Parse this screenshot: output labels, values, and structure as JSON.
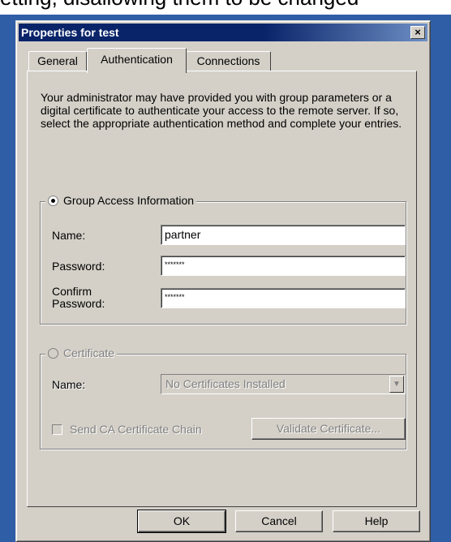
{
  "background_text": "etting, disallowing them to be changed",
  "dialog": {
    "title": "Properties for test",
    "close_glyph": "×"
  },
  "tabs": [
    {
      "label": "General",
      "active": false
    },
    {
      "label": "Authentication",
      "active": true
    },
    {
      "label": "Connections",
      "active": false
    }
  ],
  "intro_text": "Your administrator may have provided you with group parameters or a digital certificate to authenticate your access to the remote server.  If so, select the appropriate authentication method and complete your entries.",
  "group_access": {
    "legend": "Group Access Information",
    "selected": true,
    "name_label": "Name:",
    "name_value": "partner",
    "password_label": "Password:",
    "password_value": "*******",
    "confirm_label": "Confirm Password:",
    "confirm_value": "*******"
  },
  "certificate": {
    "legend": "Certificate",
    "selected": false,
    "enabled": false,
    "name_label": "Name:",
    "select_value": "No Certificates Installed",
    "send_chain_label": "Send CA Certificate Chain",
    "validate_button": "Validate Certificate..."
  },
  "buttons": {
    "ok": "OK",
    "cancel": "Cancel",
    "help": "Help"
  },
  "colors": {
    "titlebar": "#0a246a",
    "dialog_face": "#d4d0c8",
    "desktop": "#2f5ea7"
  }
}
